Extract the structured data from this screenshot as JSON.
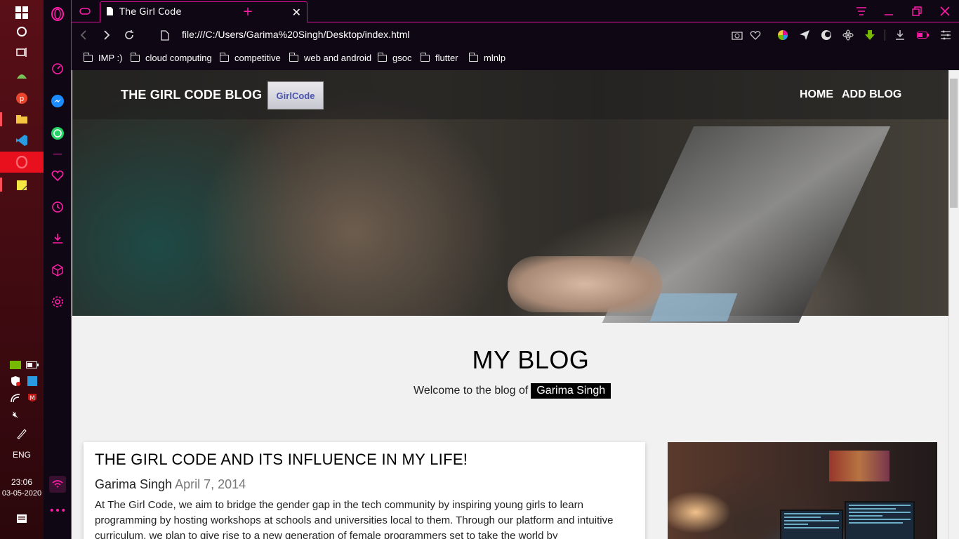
{
  "taskbar": {
    "clock_time": "23:06",
    "clock_date": "03-05-2020",
    "language": "ENG"
  },
  "browser": {
    "tab_title": "The Girl Code",
    "url": "file:///C:/Users/Garima%20Singh/Desktop/index.html",
    "bookmarks": [
      "IMP :)",
      "cloud computing",
      "competitive",
      "web and android",
      "gsoc",
      "flutter",
      "mlnlp"
    ],
    "accent_color": "#e0109c"
  },
  "site": {
    "brand": "THE GIRL CODE BLOG",
    "logo_text": "GirlCode",
    "nav": [
      "HOME",
      "ADD BLOG"
    ],
    "heading": "MY BLOG",
    "welcome_prefix": "Welcome to the blog of",
    "welcome_author": "Garima Singh",
    "post": {
      "title": "THE GIRL CODE AND ITS INFLUENCE IN MY LIFE!",
      "author": "Garima Singh",
      "date": "April 7, 2014",
      "body": "At The Girl Code, we aim to bridge the gender gap in the tech community by inspiring young girls to learn programming by hosting workshops at schools and universities local to them. Through our platform and intuitive curriculum, we plan to give rise to a new generation of female programmers set to take the world by"
    }
  }
}
